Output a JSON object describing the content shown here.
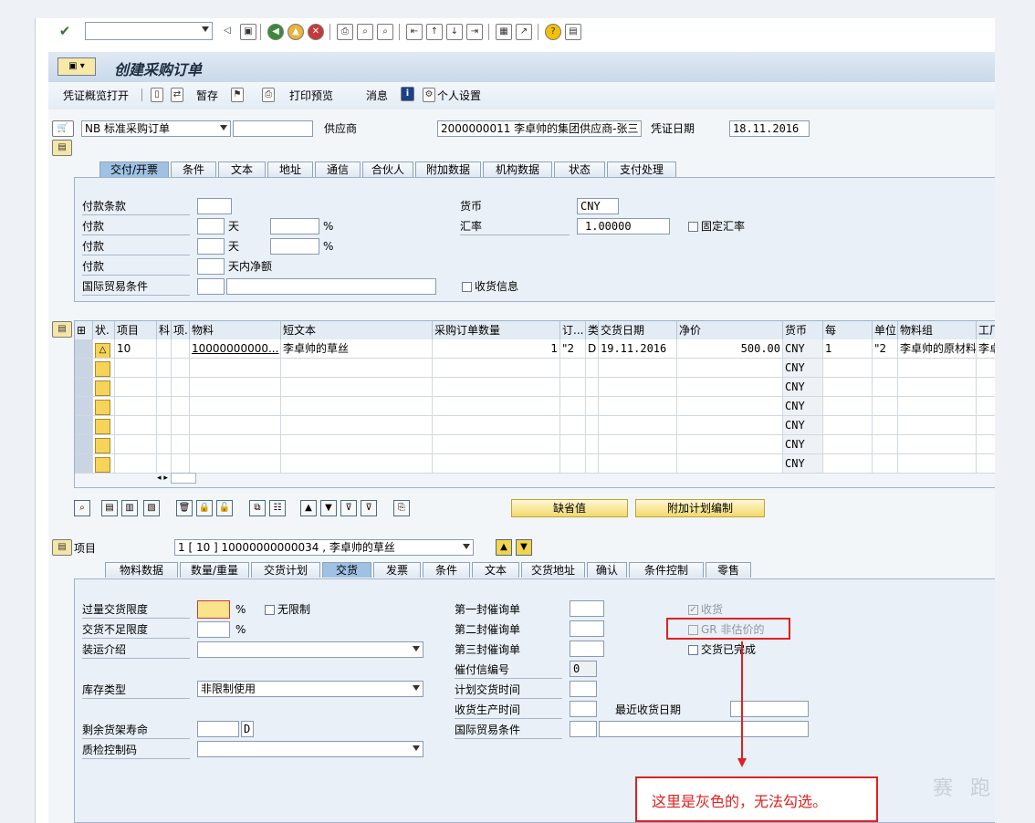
{
  "window": {
    "title": "创建采购订单"
  },
  "menu": {
    "items": [
      "凭证概览打开",
      "暂存",
      "打印预览",
      "消息",
      "个人设置"
    ]
  },
  "header": {
    "doc_type": "NB 标准采购订单",
    "vendor_label": "供应商",
    "vendor_value": "2000000011 李卓帅的集团供应商-张三",
    "doc_date_label": "凭证日期",
    "doc_date_value": "18.11.2016"
  },
  "header_tabs": [
    "交付/开票",
    "条件",
    "文本",
    "地址",
    "通信",
    "合伙人",
    "附加数据",
    "机构数据",
    "状态",
    "支付处理"
  ],
  "header_panel": {
    "payment_terms": "付款条款",
    "pay1": "付款",
    "pay2": "付款",
    "pay3": "付款",
    "days": "天",
    "days2": "天",
    "net_days": "天内净额",
    "percent": "%",
    "percent2": "%",
    "incoterms": "国际贸易条件",
    "currency_label": "货币",
    "currency_value": "CNY",
    "rate_label": "汇率",
    "rate_value": "1.00000",
    "fixed_rate": "固定汇率",
    "gr_msg": "收货信息"
  },
  "grid": {
    "headers": [
      "状.",
      "项目",
      "科",
      "项.",
      "物料",
      "短文本",
      "采购订单数量",
      "订...",
      "类",
      "交货日期",
      "净价",
      "货币",
      "每",
      "单位",
      "物料组",
      "工厂"
    ],
    "row1": {
      "item": "10",
      "material": "10000000000...",
      "short_text": "李卓帅的草丝",
      "qty": "1",
      "order_unit": "\"2",
      "cat": "D",
      "deliv_date": "19.11.2016",
      "price": "500.00",
      "currency": "CNY",
      "per": "1",
      "unit": "\"2",
      "matl_group": "李卓帅的原材料",
      "plant": "李卓"
    },
    "empty_currency": "CNY"
  },
  "buttons": {
    "default_values": "缺省值",
    "add_planning": "附加计划编制"
  },
  "item_section": {
    "label": "项目",
    "selected": "1 [ 10 ] 10000000000034 , 李卓帅的草丝"
  },
  "item_tabs": [
    "物料数据",
    "数量/重量",
    "交货计划",
    "交货",
    "发票",
    "条件",
    "文本",
    "交货地址",
    "确认",
    "条件控制",
    "零售"
  ],
  "delivery": {
    "over_tol": "过量交货限度",
    "unlimited": "无限制",
    "under_tol": "交货不足限度",
    "shipping": "装运介绍",
    "stock_type_label": "库存类型",
    "stock_type_value": "非限制使用",
    "shelf_life": "剩余货架寿命",
    "shelf_unit": "D",
    "qc_key": "质检控制码",
    "reminder1": "第一封催询单",
    "reminder2": "第二封催询单",
    "reminder3": "第三封催询单",
    "reminder_no_label": "催付信编号",
    "reminder_no_value": "0",
    "plan_deliv_time": "计划交货时间",
    "gr_proc_time": "收货生产时间",
    "latest_gr_date": "最近收货日期",
    "incoterms": "国际贸易条件",
    "goods_receipt": "收货",
    "gr_non_valuated": "GR 非估价的",
    "deliv_complete": "交货已完成",
    "pct": "%",
    "pct2": "%"
  },
  "annotation": {
    "text": "这里是灰色的，无法勾选。",
    "color": "#e02020"
  },
  "watermark": "赛 跑"
}
